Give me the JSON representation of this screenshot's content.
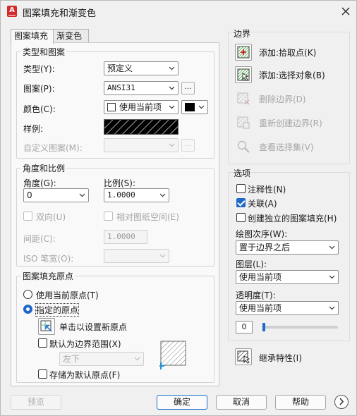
{
  "window": {
    "title": "图案填充和渐变色",
    "app_icon_letter": "A"
  },
  "tabs": [
    {
      "label": "图案填充",
      "active": true
    },
    {
      "label": "渐变色",
      "active": false
    }
  ],
  "type_pattern": {
    "group_title": "类型和图案",
    "type_label": "类型(Y):",
    "type_value": "预定义",
    "pattern_label": "图案(P):",
    "pattern_value": "ANSI31",
    "pattern_ellipsis": "...",
    "color_label": "颜色(C):",
    "color_value": "使用当前项",
    "swatch_label": "样例:",
    "custom_pattern_label": "自定义图案(M):",
    "custom_ellipsis": "..."
  },
  "angle_scale": {
    "group_title": "角度和比例",
    "angle_label": "角度(G):",
    "angle_value": "0",
    "scale_label": "比例(S):",
    "scale_value": "1.0000",
    "double_label": "双向(U)",
    "relative_label": "相对图纸空间(E)",
    "spacing_label": "间距(C):",
    "spacing_value": "1.0000",
    "iso_label": "ISO 笔宽(O):"
  },
  "origin": {
    "group_title": "图案填充原点",
    "use_current_label": "使用当前原点(T)",
    "specified_label": "指定的原点",
    "click_set_label": "单击以设置新原点",
    "default_extent_label": "默认为边界范围(X)",
    "extent_value": "左下",
    "store_default_label": "存储为默认原点(F)"
  },
  "boundary": {
    "section_title": "边界",
    "add_pick_points": "添加:拾取点(K)",
    "add_select_objects": "添加:选择对象(B)",
    "remove_boundaries": "删除边界(D)",
    "recreate_boundary": "重新创建边界(R)",
    "view_selections": "查看选择集(V)"
  },
  "options": {
    "section_title": "选项",
    "annotative_label": "注释性(N)",
    "annotative_checked": false,
    "associative_label": "关联(A)",
    "associative_checked": true,
    "independent_label": "创建独立的图案填充(H)",
    "independent_checked": false,
    "draw_order_label": "绘图次序(W):",
    "draw_order_value": "置于边界之后",
    "layer_label": "图层(L):",
    "layer_value": "使用当前项",
    "transparency_label": "透明度(T):",
    "transparency_value_label": "使用当前项",
    "transparency_number": "0",
    "transparency_level": 0
  },
  "inherit_label": "继承特性(I)",
  "buttons": {
    "preview": "预览",
    "ok": "确定",
    "cancel": "取消",
    "help": "帮助"
  },
  "colors": {
    "accent": "#1e68c9",
    "origin_marker": "#1e90e0"
  },
  "icons": {
    "pick_points": "pick-points-icon",
    "select_objects": "select-objects-icon",
    "remove_boundaries": "remove-boundaries-icon",
    "recreate_boundary": "recreate-boundary-icon",
    "view_selections": "magnifier-icon",
    "inherit": "inherit-properties-icon",
    "more": "chevron-right-circle-icon"
  }
}
